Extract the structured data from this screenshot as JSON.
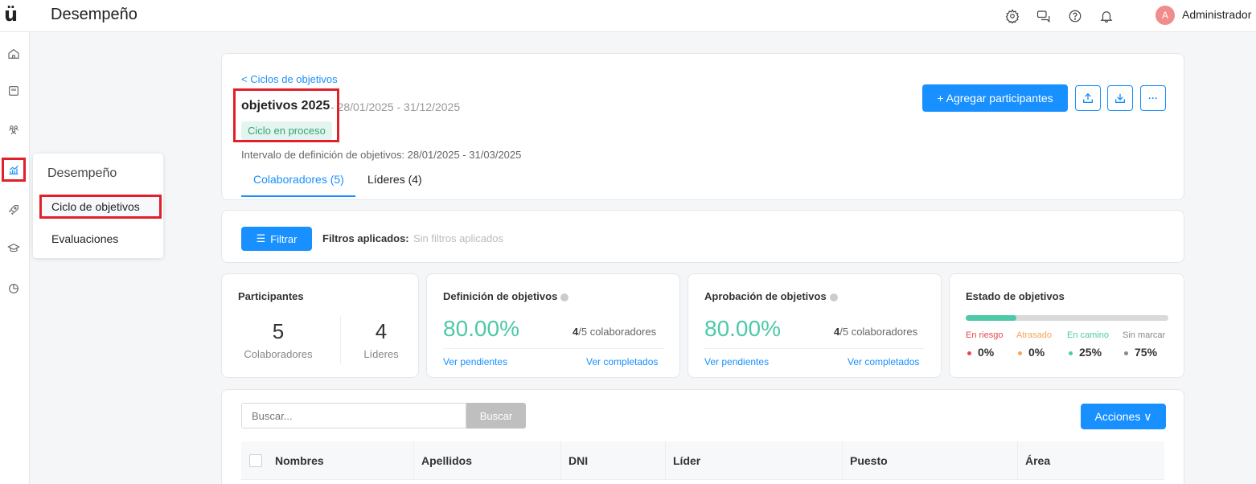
{
  "app": {
    "logo": "ü",
    "title": "Desempeño"
  },
  "topbar": {
    "icons": [
      "gear-icon",
      "chat-icon",
      "help-icon",
      "bell-icon"
    ],
    "avatar_initial": "A",
    "user_name": "Administrador"
  },
  "rail": {
    "icons": [
      "home-icon",
      "calendar-icon",
      "people-icon",
      "performance-chart-icon",
      "rocket-icon",
      "graduation-cap-icon",
      "pie-chart-icon"
    ]
  },
  "flyout": {
    "title": "Desempeño",
    "items": [
      {
        "label": "Ciclo de objetivos"
      },
      {
        "label": "Evaluaciones"
      }
    ]
  },
  "header": {
    "back_link": "< Ciclos de objetivos",
    "cycle_name": "objetivos 2025",
    "cycle_dates": "- 28/01/2025 - 31/12/2025",
    "status": "Ciclo en proceso",
    "interval": "Intervalo de definición de objetivos: 28/01/2025 - 31/03/2025",
    "tabs": [
      {
        "label": "Colaboradores (5)"
      },
      {
        "label": "Líderes (4)"
      }
    ],
    "add_button": "+ Agregar participantes",
    "more_label": "···"
  },
  "filters": {
    "button": "Filtrar",
    "applied_label": "Filtros aplicados:",
    "applied_value": "Sin filtros aplicados"
  },
  "stats": {
    "participants": {
      "title": "Participantes",
      "colaboradores_count": "5",
      "colaboradores_label": "Colaboradores",
      "lideres_count": "4",
      "lideres_label": "Líderes"
    },
    "definicion": {
      "title": "Definición de objetivos",
      "percent": "80.00%",
      "done": "4",
      "ratio_rest": "/5 colaboradores",
      "link_pending": "Ver pendientes",
      "link_done": "Ver completados"
    },
    "aprobacion": {
      "title": "Aprobación de objetivos",
      "percent": "80.00%",
      "done": "4",
      "ratio_rest": "/5 colaboradores",
      "link_pending": "Ver pendientes",
      "link_done": "Ver completados"
    },
    "estado": {
      "title": "Estado de objetivos",
      "progress_fraction": 0.25,
      "items": [
        {
          "label": "En riesgo",
          "value": "0%",
          "color": "#e8474f"
        },
        {
          "label": "Atrasado",
          "value": "0%",
          "color": "#f5a55a"
        },
        {
          "label": "En camino",
          "value": "25%",
          "color": "#4ec9a8"
        },
        {
          "label": "Sin marcar",
          "value": "75%",
          "color": "#888888"
        }
      ]
    }
  },
  "table": {
    "search_placeholder": "Buscar...",
    "search_button": "Buscar",
    "actions_button": "Acciones ∨",
    "columns": [
      "Nombres",
      "Apellidos",
      "DNI",
      "Líder",
      "Puesto",
      "Área"
    ]
  },
  "colors": {
    "accent": "#1890ff",
    "success": "#4ec9a8",
    "highlight": "#e0202a"
  }
}
